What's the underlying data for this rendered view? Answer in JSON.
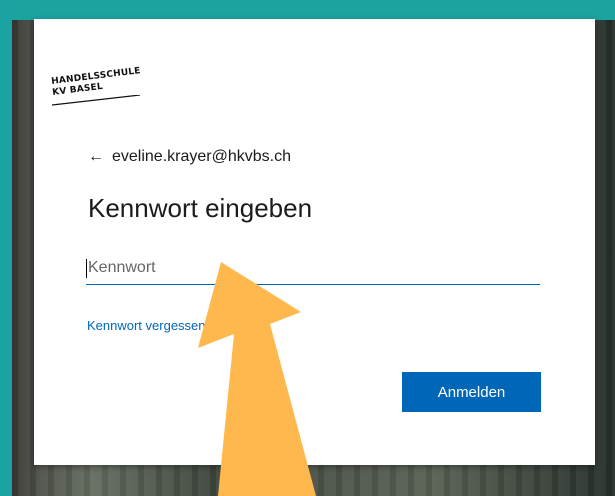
{
  "logo": {
    "line1": "HANDELSSCHULE",
    "line2": "KV BASEL"
  },
  "account": {
    "back_icon": "back-arrow-icon",
    "email": "eveline.krayer@hkvbs.ch"
  },
  "heading": "Kennwort eingeben",
  "password_field": {
    "placeholder": "Kennwort",
    "value": ""
  },
  "forgot_link": "Kennwort vergessen?",
  "signin_button": "Anmelden",
  "colors": {
    "accent": "#0067b8",
    "frame": "#1aa3a0",
    "annotation_arrow": "#ffb84d"
  }
}
